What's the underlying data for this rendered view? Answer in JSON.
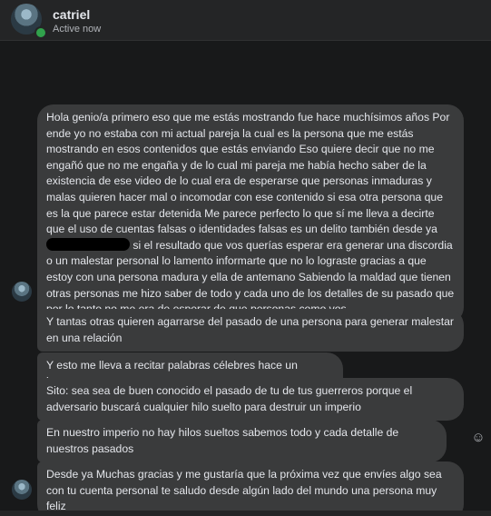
{
  "header": {
    "name": "catriel",
    "status": "Active now"
  },
  "messages": {
    "m1": "Hola genio/a primero eso que me estás mostrando fue hace muchísimos años Por ende yo no estaba con mi actual pareja la cual es la persona que me estás mostrando en esos contenidos que estás enviando Eso quiere decir que no me engañó que no me engaña y de lo cual mi pareja me había hecho saber de la existencia de ese video de lo cual era de esperarse que personas inmaduras y malas quieren hacer mal o incomodar con ese contenido si esa otra persona que es la que parece estar detenida Me parece perfecto lo que sí me lleva a decirte que el uso de cuentas falsas o identidades falsas es un delito también desde ya",
    "m1_after": "si el resultado que vos querías esperar era generar una discordia o un malestar personal lo lamento informarte que no lo lograste gracias a que estoy con una persona madura y ella de antemano Sabiendo la maldad que tienen otras personas me hizo saber de todo y cada uno de los detalles de su pasado que por lo tanto no me era de esperar de que personas como vos",
    "m2": "Y tantas otras quieren agarrarse del pasado de una persona para generar malestar en una relación",
    "m3": "Y esto me lleva a recitar palabras célebres hace un ignorante",
    "m4": "Sito: sea sea de buen conocido el pasado de tu de tus guerreros porque el adversario buscará cualquier hilo suelto para destruir un imperio",
    "m5": "En nuestro imperio no hay hilos sueltos sabemos todo y cada detalle de nuestros pasados",
    "m6": "Desde ya Muchas gracias y me gustaría que la próxima vez que envíes algo sea con tu cuenta personal te saludo desde algún lado del mundo una persona muy feliz"
  },
  "icons": {
    "react": "smiley-icon"
  }
}
